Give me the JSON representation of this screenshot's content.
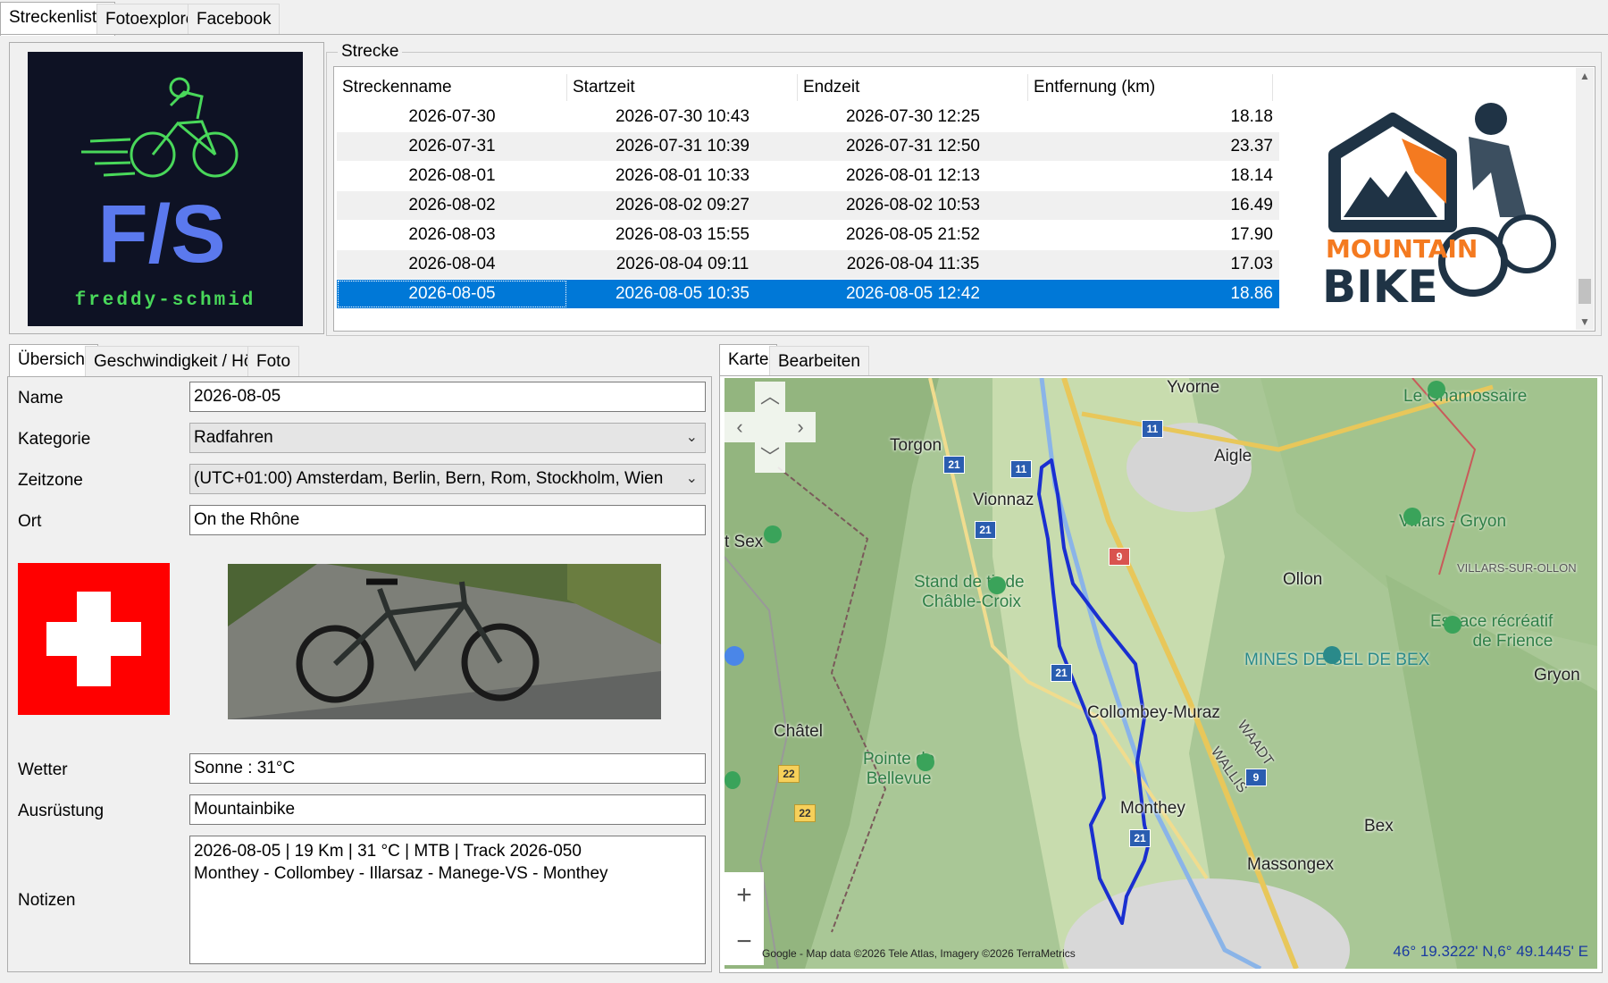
{
  "top_tabs": [
    "Streckenliste",
    "Fotoexplorer",
    "Facebook"
  ],
  "logo_left": {
    "initials": "F/S",
    "name": "freddy-schmid"
  },
  "logo_right": {
    "line1": "MOUNTAIN",
    "line2": "BIKE"
  },
  "strecke": {
    "group_label": "Strecke",
    "columns": [
      "Streckenname",
      "Startzeit",
      "Endzeit",
      "Entfernung (km)"
    ],
    "rows": [
      [
        "2026-07-30",
        "2026-07-30 10:43",
        "2026-07-30 12:25",
        "18.18"
      ],
      [
        "2026-07-31",
        "2026-07-31 10:39",
        "2026-07-31 12:50",
        "23.37"
      ],
      [
        "2026-08-01",
        "2026-08-01 10:33",
        "2026-08-01 12:13",
        "18.14"
      ],
      [
        "2026-08-02",
        "2026-08-02 09:27",
        "2026-08-02 10:53",
        "16.49"
      ],
      [
        "2026-08-03",
        "2026-08-03 15:55",
        "2026-08-05 21:52",
        "17.90"
      ],
      [
        "2026-08-04",
        "2026-08-04 09:11",
        "2026-08-04 11:35",
        "17.03"
      ],
      [
        "2026-08-05",
        "2026-08-05 10:35",
        "2026-08-05 12:42",
        "18.86"
      ]
    ],
    "selected_index": 6
  },
  "detail_tabs": [
    "Übersicht",
    "Geschwindigkeit / Höhe",
    "Foto"
  ],
  "form": {
    "name_label": "Name",
    "name_value": "2026-08-05",
    "kategorie_label": "Kategorie",
    "kategorie_value": "Radfahren",
    "zeitzone_label": "Zeitzone",
    "zeitzone_value": "(UTC+01:00) Amsterdam, Berlin, Bern, Rom, Stockholm, Wien",
    "ort_label": "Ort",
    "ort_value": "On the Rhône",
    "wetter_label": "Wetter",
    "wetter_value": "Sonne  :  31°C",
    "ausruestung_label": "Ausrüstung",
    "ausruestung_value": "Mountainbike",
    "notizen_label": "Notizen",
    "notizen_line1": "2026-08-05  |  19 Km  |  31 °C  |  MTB  |  Track 2026-050",
    "notizen_line2": "Monthey - Collombey - Illarsaz - Manege-VS - Monthey"
  },
  "map_tabs": [
    "Karte",
    "Bearbeiten"
  ],
  "map": {
    "places": [
      "Yvorne",
      "Torgon",
      "Aigle",
      "Vionnaz",
      "Ollon",
      "Collombey-Muraz",
      "Monthey",
      "Bex",
      "Massongex",
      "Châtel",
      "Gryon",
      "VILLARS-SUR-OLLON",
      "WAADT",
      "WALLIS",
      "t Sex"
    ],
    "pois": [
      "Le Chamossaire",
      "Villars - Gryon",
      "Stand de tir de\nChâble-Croix",
      "Espace récréatif\nde Frience",
      "MINES DE SEL DE BEX",
      "Pointe de\nBellevue"
    ],
    "road_numbers": [
      "11",
      "21",
      "9",
      "22"
    ],
    "attribution": "Google - Map data ©2026 Tele Atlas, Imagery ©2026 TerraMetrics",
    "coordinates": "46° 19.3222' N,6° 49.1445' E",
    "zoom_in": "+",
    "zoom_out": "−",
    "track_color": "#1a2fd0"
  },
  "colors": {
    "selection": "#0078d7",
    "swiss_red": "#ff0000"
  }
}
